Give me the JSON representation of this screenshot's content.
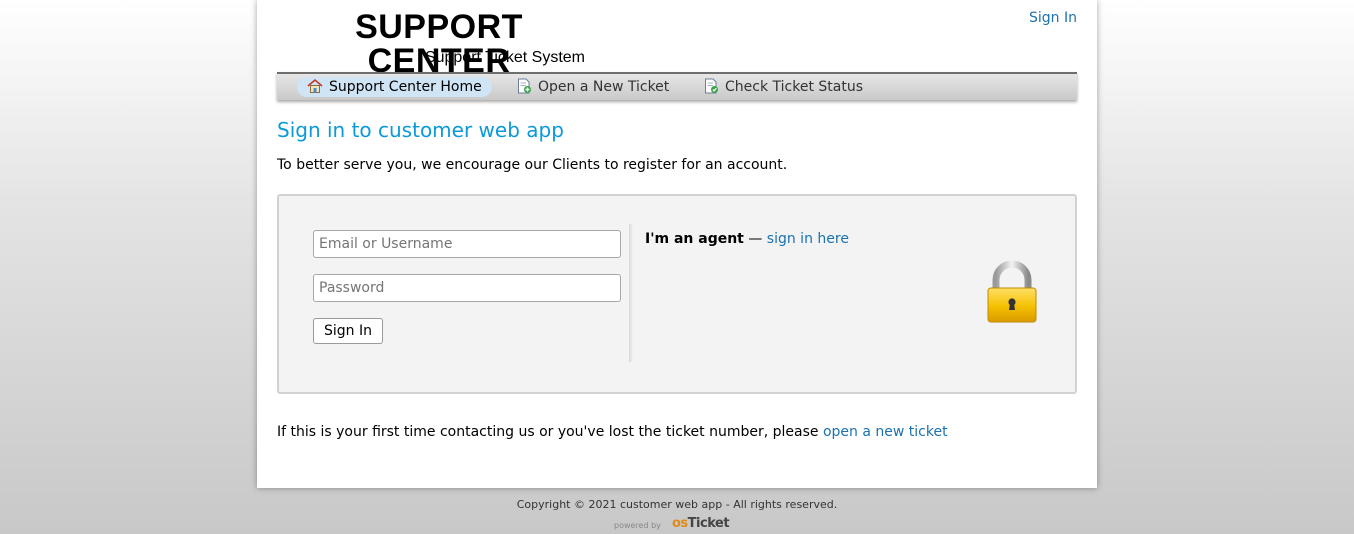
{
  "header": {
    "logo_title": "SUPPORT CENTER",
    "logo_subtitle": "Support Ticket System",
    "signin_link": "Sign In"
  },
  "nav": {
    "items": [
      {
        "label": "Support Center Home",
        "icon": "home-icon",
        "active": true
      },
      {
        "label": "Open a New Ticket",
        "icon": "new-ticket-icon",
        "active": false
      },
      {
        "label": "Check Ticket Status",
        "icon": "ticket-status-icon",
        "active": false
      }
    ]
  },
  "main": {
    "title": "Sign in to customer web app",
    "intro": "To better serve you, we encourage our Clients to register for an account.",
    "login": {
      "email_placeholder": "Email or Username",
      "password_placeholder": "Password",
      "signin_button": "Sign In"
    },
    "agent": {
      "prefix": "I'm an agent",
      "dash": "—",
      "link": "sign in here"
    },
    "first_time_text": "If this is your first time contacting us or you've lost the ticket number, please",
    "first_time_link": "open a new ticket"
  },
  "footer": {
    "copyright": "Copyright © 2021 customer web app - All rights reserved.",
    "powered_by": "powered by",
    "brand_os": "os",
    "brand_ticket": "Ticket"
  },
  "colors": {
    "title_blue": "#0b9ad9",
    "link_blue": "#1a72b0",
    "lock_gold": "#f1c232"
  }
}
